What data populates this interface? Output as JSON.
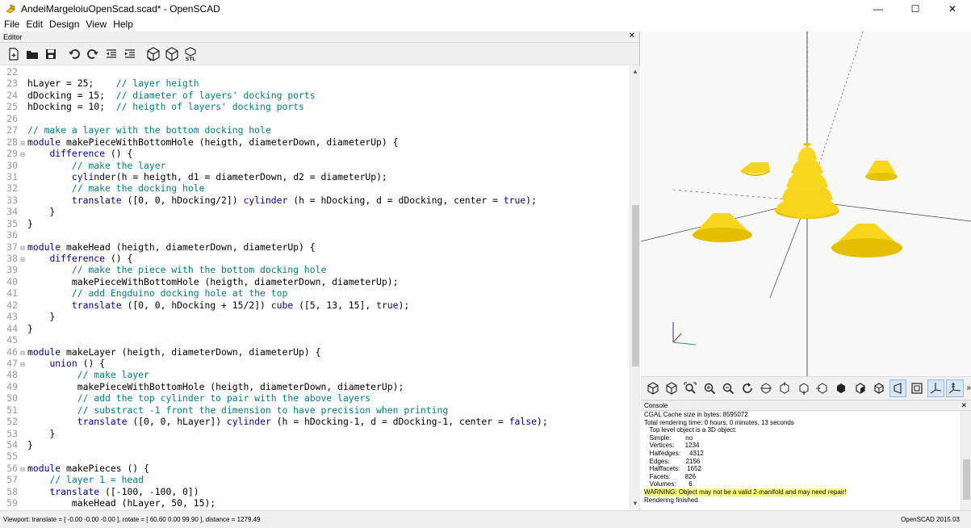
{
  "window": {
    "title": "AndeiMargeloiuOpenScad.scad* - OpenSCAD",
    "minimize": "—",
    "maximize": "☐",
    "close": "✕"
  },
  "menu": {
    "items": [
      "File",
      "Edit",
      "Design",
      "View",
      "Help"
    ]
  },
  "editor": {
    "header": "Editor",
    "close": "✕"
  },
  "code_lines": [
    {
      "n": "22",
      "fold": "",
      "html": ""
    },
    {
      "n": "23",
      "fold": "",
      "html": "hLayer = 25;    <span class='cm'>// layer heigth</span>"
    },
    {
      "n": "24",
      "fold": "",
      "html": "dDocking = 15;  <span class='cm'>// diameter of layers' docking ports</span>"
    },
    {
      "n": "25",
      "fold": "",
      "html": "hDocking = 10;  <span class='cm'>// heigth of layers' docking ports</span>"
    },
    {
      "n": "26",
      "fold": "",
      "html": ""
    },
    {
      "n": "27",
      "fold": "",
      "html": "<span class='cm'>// make a layer with the bottom docking hole</span>"
    },
    {
      "n": "28",
      "fold": "⊟",
      "html": "<span class='kw'>module</span> makePieceWithBottomHole (heigth, diameterDown, diameterUp) {"
    },
    {
      "n": "29",
      "fold": "⊟",
      "html": "    <span class='kw'>difference</span> () {"
    },
    {
      "n": "30",
      "fold": "",
      "html": "        <span class='cm'>// make the layer</span>"
    },
    {
      "n": "31",
      "fold": "",
      "html": "        <span class='kw'>cylinder</span>(h = heigth, d1 = diameterDown, d2 = diameterUp);"
    },
    {
      "n": "32",
      "fold": "",
      "html": "        <span class='cm'>// make the docking hole</span>"
    },
    {
      "n": "33",
      "fold": "",
      "html": "        <span class='kw'>translate</span> ([0, 0, hDocking/2]) <span class='kw'>cylinder</span> (h = hDocking, d = dDocking, center = <span class='kw'>true</span>);"
    },
    {
      "n": "34",
      "fold": "",
      "html": "    }"
    },
    {
      "n": "35",
      "fold": "",
      "html": "}"
    },
    {
      "n": "36",
      "fold": "",
      "html": ""
    },
    {
      "n": "37",
      "fold": "⊟",
      "html": "<span class='kw'>module</span> makeHead (heigth, diameterDown, diameterUp) {"
    },
    {
      "n": "38",
      "fold": "⊟",
      "html": "    <span class='kw'>difference</span> () {"
    },
    {
      "n": "39",
      "fold": "",
      "html": "        <span class='cm'>// make the piece with the bottom docking hole</span>"
    },
    {
      "n": "40",
      "fold": "",
      "html": "        makePieceWithBottomHole (heigth, diameterDown, diameterUp);"
    },
    {
      "n": "41",
      "fold": "",
      "html": "        <span class='cm'>// add Engduino docking hole at the top</span>"
    },
    {
      "n": "42",
      "fold": "",
      "html": "        <span class='kw'>translate</span> ([0, 0, hDocking + 15/2]) <span class='kw'>cube</span> ([5, 13, 15], <span class='kw'>true</span>);"
    },
    {
      "n": "43",
      "fold": "",
      "html": "    }"
    },
    {
      "n": "44",
      "fold": "",
      "html": "}"
    },
    {
      "n": "45",
      "fold": "",
      "html": ""
    },
    {
      "n": "46",
      "fold": "⊟",
      "html": "<span class='kw'>module</span> makeLayer (heigth, diameterDown, diameterUp) {"
    },
    {
      "n": "47",
      "fold": "⊟",
      "html": "    <span class='kw'>union</span> () {"
    },
    {
      "n": "48",
      "fold": "",
      "html": "         <span class='cm'>// make layer</span>"
    },
    {
      "n": "49",
      "fold": "",
      "html": "         makePieceWithBottomHole (heigth, diameterDown, diameterUp);"
    },
    {
      "n": "50",
      "fold": "",
      "html": "         <span class='cm'>// add the top cylinder to pair with the above layers</span>"
    },
    {
      "n": "51",
      "fold": "",
      "html": "         <span class='cm'>// substract -1 front the dimension to have precision when printing</span>"
    },
    {
      "n": "52",
      "fold": "",
      "html": "         <span class='kw'>translate</span> ([0, 0, hLayer]) <span class='kw'>cylinder</span> (h = hDocking-1, d = dDocking-1, center = <span class='kw'>false</span>);"
    },
    {
      "n": "53",
      "fold": "",
      "html": "    }"
    },
    {
      "n": "54",
      "fold": "",
      "html": "}"
    },
    {
      "n": "55",
      "fold": "",
      "html": ""
    },
    {
      "n": "56",
      "fold": "⊟",
      "html": "<span class='kw'>module</span> makePieces () {"
    },
    {
      "n": "57",
      "fold": "",
      "html": "    <span class='cm'>// layer 1 = head</span>"
    },
    {
      "n": "58",
      "fold": "",
      "html": "    <span class='kw'>translate</span> ([-100, -100, 0])"
    },
    {
      "n": "59",
      "fold": "",
      "html": "        makeHead (hLayer, 50, 15);"
    }
  ],
  "console": {
    "header": "Console",
    "close": "✕",
    "lines": [
      {
        "text": "CGAL Cache size in bytes: 8595072",
        "cls": ""
      },
      {
        "text": "Total rendering time: 0 hours, 0 minutes, 13 seconds",
        "cls": ""
      },
      {
        "text": "   Top level object is a 3D object:",
        "cls": ""
      },
      {
        "text": "   Simple:        no",
        "cls": "indent"
      },
      {
        "text": "   Vertices:      1234",
        "cls": "indent"
      },
      {
        "text": "   Halfedges:     4312",
        "cls": "indent"
      },
      {
        "text": "   Edges:         2156",
        "cls": "indent"
      },
      {
        "text": "   Halffacets:    1652",
        "cls": "indent"
      },
      {
        "text": "   Facets:        826",
        "cls": "indent"
      },
      {
        "text": "   Volumes:       6",
        "cls": "indent"
      },
      {
        "text": "WARNING: Object may not be a valid 2-manifold and may need repair!",
        "cls": "warn"
      },
      {
        "text": "Rendering finished.",
        "cls": ""
      }
    ]
  },
  "statusbar": {
    "viewport": "Viewport: translate = [ -0.00 -0.00 -0.00 ], rotate = [ 60.60 0.00 99.90 ], distance = 1279.49",
    "version": "OpenSCAD 2015.03"
  },
  "colors": {
    "object_yellow": "#f9d72c",
    "object_shadow": "#e0b800",
    "keyword": "#0000a0",
    "comment": "#008080"
  }
}
